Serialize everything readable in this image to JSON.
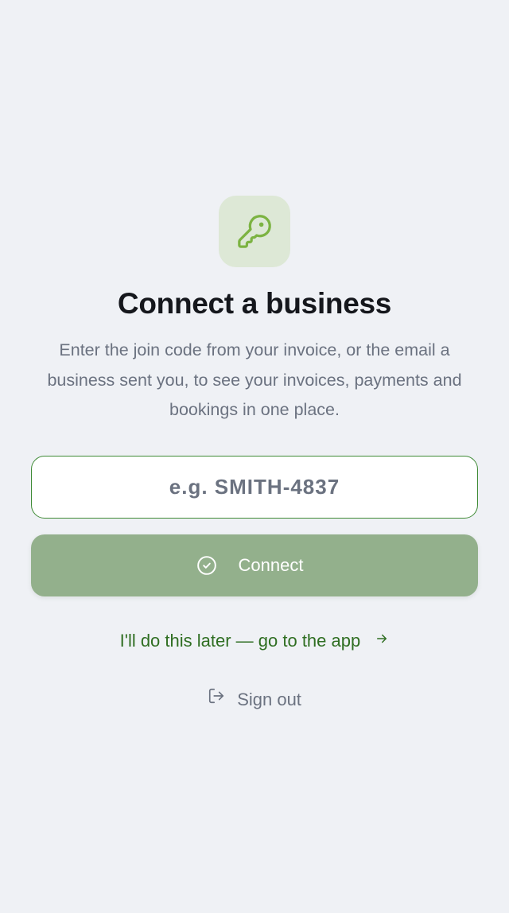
{
  "header": {
    "icon": "key-icon",
    "title": "Connect a business",
    "subtitle": "Enter the join code from your invoice, or the email a business sent you, to see your invoices, payments and bookings in one place."
  },
  "form": {
    "code_input": {
      "value": "",
      "placeholder": "e.g. SMITH-4837"
    },
    "connect_button": {
      "label": "Connect",
      "icon": "check-circle-icon"
    }
  },
  "links": {
    "later": {
      "label": "I'll do this later — go to the app",
      "icon": "arrow-right-icon"
    },
    "sign_out": {
      "label": "Sign out",
      "icon": "sign-out-icon"
    }
  },
  "colors": {
    "background": "#eff1f5",
    "icon_tile": "#dde8d6",
    "icon_stroke": "#7cb342",
    "accent_green": "#2f6e22",
    "input_border": "#3e8a35",
    "button_disabled": "#93b08c",
    "title_text": "#15171c",
    "muted_text": "#6b7280"
  }
}
